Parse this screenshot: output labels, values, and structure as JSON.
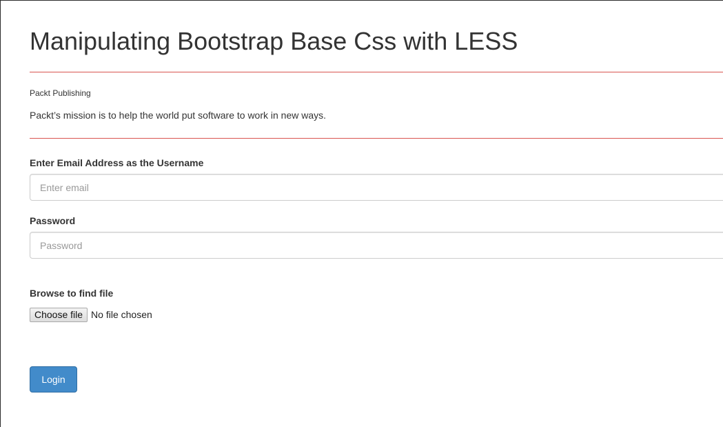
{
  "page": {
    "title": "Manipulating Bootstrap Base Css with LESS",
    "publisher": "Packt Publishing",
    "mission": "Packt’s mission is to help the world put software to work in new ways."
  },
  "form": {
    "email": {
      "label": "Enter Email Address as the Username",
      "placeholder": "Enter email",
      "value": ""
    },
    "password": {
      "label": "Password",
      "placeholder": "Password",
      "value": ""
    },
    "file": {
      "label": "Browse to find file",
      "button_label": "Choose file",
      "status": "No file chosen"
    },
    "submit_label": "Login"
  },
  "colors": {
    "accent_rule": "#d9534f",
    "primary_button": "#428bca"
  }
}
